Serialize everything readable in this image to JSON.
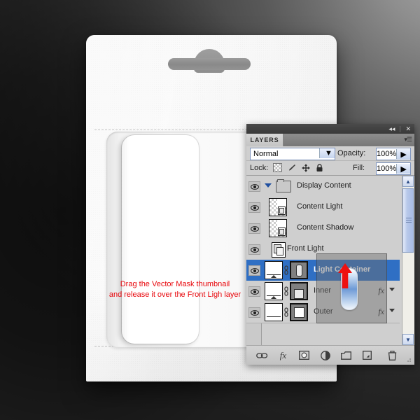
{
  "scene": {
    "description_alt": "Photoshop layers panel over white package mockup"
  },
  "hint": {
    "line1": "Drag the Vector Mask thumbnail",
    "line2": "and release it over the Front Ligh layer",
    "color": "#e8060b"
  },
  "panel": {
    "titlebar": {
      "collapse_icon": "◂◂",
      "close_icon": "✕"
    },
    "tab_label": "LAYERS",
    "menu_icon": "▾☰",
    "blend": {
      "label": "Normal",
      "arrow_icon": "▼"
    },
    "opacity": {
      "label": "Opacity:",
      "value": "100%",
      "arrow_icon": "▶"
    },
    "fill": {
      "label": "Fill:",
      "value": "100%",
      "arrow_icon": "▶"
    },
    "lock": {
      "label": "Lock:",
      "icons": [
        "transparency-lock-icon",
        "paint-lock-icon",
        "move-lock-icon",
        "all-lock-icon"
      ]
    },
    "layers": [
      {
        "name": "Display Content",
        "kind": "group",
        "visible": true,
        "selected": false,
        "expanded": true,
        "has_fx": false
      },
      {
        "name": "Content Light",
        "kind": "pixel",
        "visible": true,
        "selected": false,
        "has_fx": false
      },
      {
        "name": "Content Shadow",
        "kind": "pixel",
        "visible": true,
        "selected": false,
        "has_fx": false
      },
      {
        "name": "Front Light",
        "kind": "smart",
        "visible": true,
        "selected": false,
        "has_fx": false
      },
      {
        "name": "Light Container",
        "kind": "shape",
        "visible": true,
        "selected": true,
        "has_fx": false
      },
      {
        "name": "Inner",
        "kind": "shape",
        "visible": true,
        "selected": false,
        "has_fx": true,
        "fx_label": "fx"
      },
      {
        "name": "Outer",
        "kind": "shape",
        "visible": true,
        "selected": false,
        "has_fx": true,
        "fx_label": "fx"
      }
    ],
    "scrollbar": {
      "up_icon": "▲",
      "down_icon": "▼"
    },
    "bottom_toolbar": [
      {
        "icon": "∞",
        "name": "link-layers-icon"
      },
      {
        "icon": "fx",
        "name": "layer-style-icon"
      },
      {
        "icon": "●",
        "name": "add-mask-icon"
      },
      {
        "icon": "◑",
        "name": "adjustment-layer-icon"
      },
      {
        "icon": "▭",
        "name": "new-group-icon"
      },
      {
        "icon": "▣",
        "name": "new-layer-icon"
      },
      {
        "icon": "Ὕ1",
        "name": "delete-layer-icon"
      }
    ]
  },
  "drag": {
    "ghost_label": "Light Container",
    "arrow_color": "#ee1111"
  }
}
